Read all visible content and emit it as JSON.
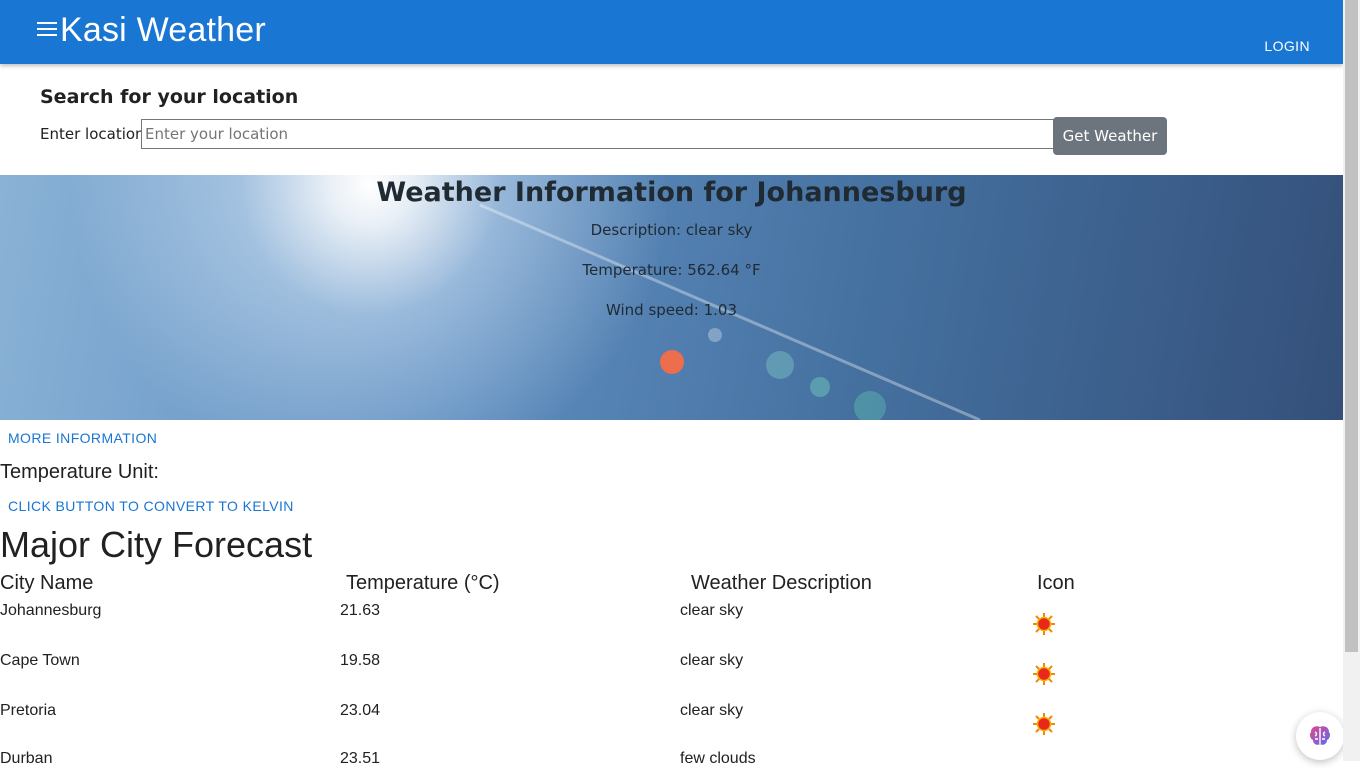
{
  "header": {
    "title": "Kasi Weather",
    "login_label": "LOGIN",
    "menu_icon": "menu-icon"
  },
  "search": {
    "heading": "Search for your location",
    "label": "Enter location:",
    "placeholder": "Enter your location",
    "value": "",
    "button_label": "Get Weather"
  },
  "weather": {
    "title": "Weather Information for Johannesburg",
    "description": "Description: clear sky",
    "temperature": "Temperature: 562.64 °F",
    "wind": "Wind speed: 1.03"
  },
  "more_info_label": "MORE INFORMATION",
  "temp_unit_label": "Temperature Unit:",
  "convert_label": "CLICK BUTTON TO CONVERT TO KELVIN",
  "forecast": {
    "title": "Major City Forecast",
    "headers": [
      "City Name",
      "Temperature (°C)",
      "Weather Description",
      "Icon"
    ],
    "rows": [
      {
        "city": "Johannesburg",
        "temp": "21.63",
        "desc": "clear sky",
        "icon": "sun-icon"
      },
      {
        "city": "Cape Town",
        "temp": "19.58",
        "desc": "clear sky",
        "icon": "sun-icon"
      },
      {
        "city": "Pretoria",
        "temp": "23.04",
        "desc": "clear sky",
        "icon": "sun-icon"
      },
      {
        "city": "Durban",
        "temp": "23.51",
        "desc": "few clouds",
        "icon": "cloud-icon"
      }
    ]
  },
  "colors": {
    "appbar": "#1976d2",
    "link": "#1976d2",
    "button": "#6c757d",
    "dot": "#ec6e4c"
  },
  "assistant_icon": "brain-icon"
}
